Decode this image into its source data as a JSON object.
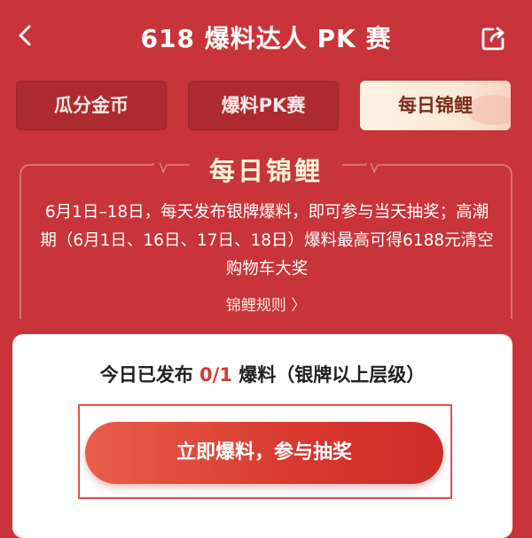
{
  "header": {
    "title": "618 爆料达人 PK 赛"
  },
  "tabs": [
    {
      "label": "瓜分金币",
      "active": false
    },
    {
      "label": "爆料PK赛",
      "active": false
    },
    {
      "label": "每日锦鲤",
      "active": true
    }
  ],
  "section": {
    "title": "每日锦鲤",
    "description": "6月1日–18日，每天发布银牌爆料，即可参与当天抽奖；高潮期（6月1日、16日、17日、18日）爆料最高可得6188元清空购物车大奖",
    "rules_link": "锦鲤规则 〉"
  },
  "card": {
    "status_prefix": "今日已发布 ",
    "status_count": "0/1",
    "status_suffix": " 爆料（银牌以上层级）",
    "cta_label": "立即爆料，参与抽奖"
  },
  "colors": {
    "background": "#c8343a",
    "accent": "#d23a2e"
  }
}
